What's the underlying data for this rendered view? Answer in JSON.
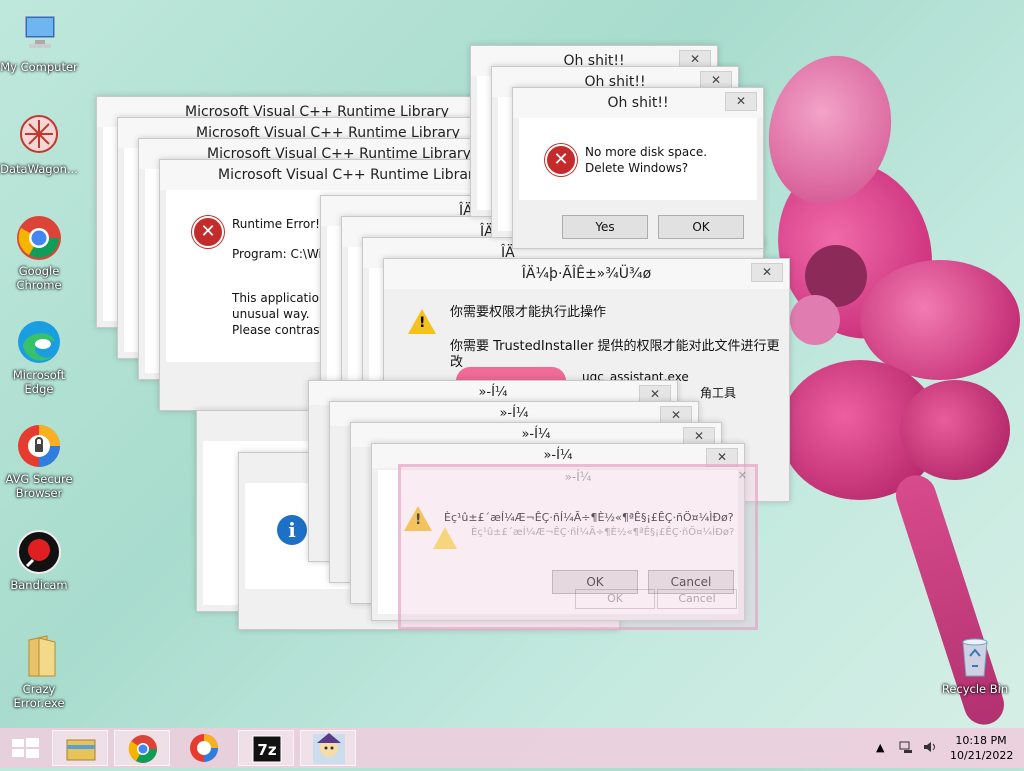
{
  "desktop": {
    "icons": [
      {
        "label": "My Computer"
      },
      {
        "label": "DataWagon..."
      },
      {
        "label": "Google Chrome"
      },
      {
        "label": "Microsoft Edge"
      },
      {
        "label": "AVG Secure Browser"
      },
      {
        "label": "Bandicam"
      },
      {
        "label": "Crazy Error.exe"
      },
      {
        "label": "Recycle Bin"
      }
    ]
  },
  "vc_dialogs": {
    "titles": [
      "Microsoft Visual C++ Runtime Library",
      "Microsoft Visual C++ Runtime Library",
      "Microsoft Visual C++ Runtime Library",
      "Microsoft Visual C++ Runtime Library"
    ],
    "heading": "Runtime Error!",
    "program": "Program: C:\\Wir",
    "message_lines": [
      "This application",
      "unusual way.",
      "Please contrast th"
    ]
  },
  "disk_dialogs": {
    "titles": [
      "Oh shit!!",
      "Oh shit!!",
      "Oh shit!!"
    ],
    "message_lines": [
      "No more disk space.",
      "Delete Windows?"
    ],
    "yes_label": "Yes",
    "ok_label": "OK"
  },
  "perm_dialogs": {
    "partial_titles": [
      "ÎÄ",
      "ÎÄ",
      "ÎÄ"
    ],
    "title": "ÎÄ¼þ·ÃÎÊ±»¾Ü¾ø",
    "line1": "你需要权限才能执行此操作",
    "line2": "你需要 TrustedInstaller 提供的权限才能对此文件进行更改",
    "file_name": "ugc_assistant.exe",
    "file_desc": "角工具"
  },
  "warn_dialogs": {
    "titles": [
      "»-Í¼",
      "»-Í¼",
      "»-Í¼",
      "»-Í¼",
      "»-Í¼"
    ],
    "message": "Èç¹û±£´æÍ¼Æ¬ÊÇ·ñÍ¼Ã÷¶È½«¶ªÊ§¡£ÊÇ·ñÖ¤¼ÌÐø?",
    "ok_label": "OK",
    "cancel_label": "Cancel"
  },
  "taskbar": {
    "time": "10:18 PM",
    "date": "10/21/2022"
  },
  "colors": {
    "error_red": "#c42b2b",
    "warning_yellow": "#f4c21b",
    "info_blue": "#1e6fc6",
    "taskbar_pink": "#ecced c"
  }
}
